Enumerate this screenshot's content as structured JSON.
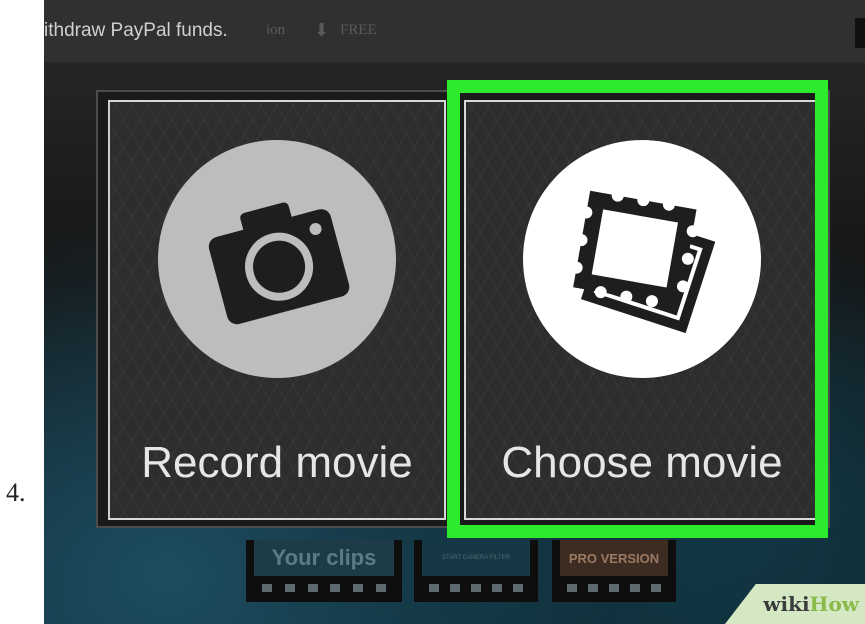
{
  "step": {
    "number": "4."
  },
  "top_bar": {
    "title": "ithdraw PayPal funds.",
    "ghost_text_1": "ion",
    "ghost_text_2": "⬇",
    "ghost_text_3": "FREE"
  },
  "dialog": {
    "record": {
      "label": "Record movie",
      "icon": "camera-icon"
    },
    "choose": {
      "label": "Choose movie",
      "icon": "photos-stack-icon",
      "highlighted": true
    }
  },
  "bottom_bar": {
    "clips_label": "Your clips",
    "start_label": "START CAMERA FILTER",
    "pro_label": "PRO VERSION"
  },
  "watermark": {
    "part1": "wiki",
    "part2": "How"
  },
  "colors": {
    "highlight": "#2eea2e",
    "card_bg": "#2d2d2d",
    "watermark_green": "#8aba4a"
  }
}
